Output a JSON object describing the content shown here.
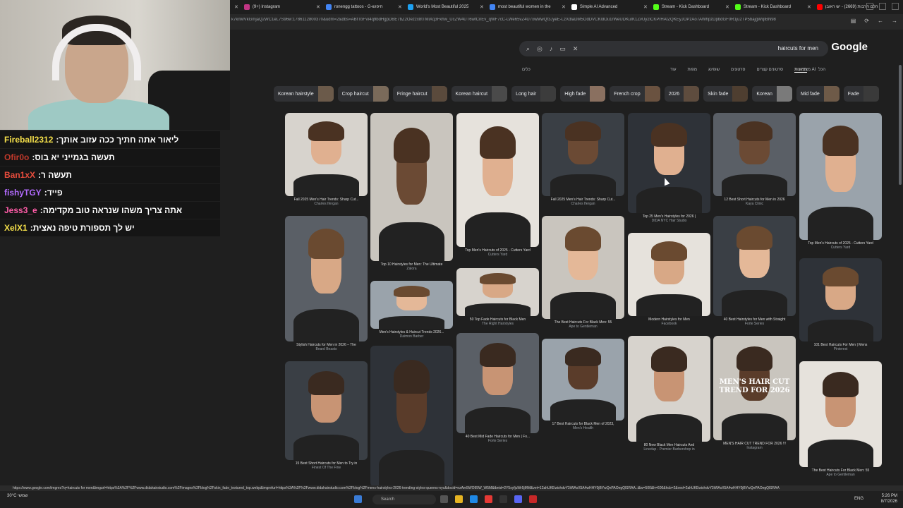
{
  "browser": {
    "tabs": [
      {
        "label": "(9+) Instagram",
        "color": "#c13584"
      },
      {
        "label": "ronengg tattoos - G-חיפוש",
        "color": "#4285f4"
      },
      {
        "label": "World's Most Beautiful 2025",
        "color": "#1da1f2"
      },
      {
        "label": "most beautiful women in the",
        "color": "#4285f4"
      },
      {
        "label": "Simple AI Advanced",
        "color": "#ffffff"
      },
      {
        "label": "Stream - Kick Dashboard",
        "color": "#53fc18"
      },
      {
        "label": "Stream - Kick Dashboard",
        "color": "#53fc18"
      },
      {
        "label": "הלם תרבות (2669) - יש ראובן",
        "color": "#ff0000"
      }
    ],
    "url": "k7knMVkGmjaQ2WC1eL7S96w:1786112800370&udm=2&dbs=ABfTbFVi4q9bdHgpDBE7bZ2Oezzx8tTMiXq3Fkhw_UcZW4UT6wfCnEv_qWF7cC-LWe65vZ4U7xwMwQf3JyeE-LzXdlaDM5OdDVCKldOu1rWeUDKuIK1ZvUy2iCKPrHAfZQKEyJOPzAo7AWhpzDpbdGF0R1ju2TP5bajgWqIBN98",
    "status_url": "https://www.google.com/imgres?q=haircuts for men&imgurl=https%3A%2F%2Fwww.didahairstudio.com%2Fimages%2Fblog%2Fskin_fade_textured_top.webp&imgrefurl=https%3A%2F%2Fwww.didahairstudio.com%2Fblog%2Fmens-hairstyles-2026-trending-styles-queens-nyc&docid=ezAm5WO95W_W5M&tbnid=2Y5syfjuWr5jMM&vet=12ahUKEwixhdvY3iWAxX5A4wHHY0jBYwQnPAOegQlSRAA..i&w=500&h=600&hcb=2&ved=2ahUKEwixhdvY3iWAxX5A4wHHY0jBYwQnPAOegQlSRAA"
  },
  "google": {
    "logo": "Google",
    "query": "haircuts for men",
    "filters": [
      "הכל",
      "תמונות",
      "סרטונים קצרים",
      "סרטונים",
      "שופינג",
      "מפות",
      "עוד"
    ],
    "active_filter": "תמונות",
    "left_tool": "כלים",
    "right_tool": "מצב AI",
    "chips": [
      "Korean hairstyle",
      "Crop haircut",
      "Fringe haircut",
      "Korean haircut",
      "Long hair",
      "High fade",
      "French crop",
      "2026",
      "Skin fade",
      "Korean",
      "Mid fade",
      "Fade"
    ]
  },
  "results": [
    {
      "caption": "Fall 2025 Men's Hair Trends: Sharp Cut...",
      "source": "Charles Ifergan"
    },
    {
      "caption": "Stylish Haircuts for Men in 2026 – The",
      "source": "Beard Beasts"
    },
    {
      "caption": "15 Best Short Haircuts for Men to Try in",
      "source": "Finest Of The Fine"
    },
    {
      "caption": "Top 10 Hairstyles for Men: The Ultimate",
      "source": "Zalora"
    },
    {
      "caption": "Men's Hairstyles & Haircut Trends 2026...",
      "source": "Daimon Barber"
    },
    {
      "caption": "",
      "source": ""
    },
    {
      "caption": "Top Men's Haircuts of 2025 - Cutters Yard",
      "source": "Cutters Yard"
    },
    {
      "caption": "50 Top Fade Haircuts for Black Men",
      "source": "The Right Hairstyles"
    },
    {
      "caption": "40 Best Mid Fade Haircuts for Men | Fo...",
      "source": "Forte Series"
    },
    {
      "caption": "Fall 2025 Men's Hair Trends: Sharp Cut...",
      "source": "Charles Ifergan"
    },
    {
      "caption": "The Best Haircuts For Black Men: 55",
      "source": "Ape to Gentleman"
    },
    {
      "caption": "17 Best Haircuts for Black Men of 2023,",
      "source": "Men's Health"
    },
    {
      "caption": "Top 25 Men's Hairstyles for 2026 |",
      "source": "DIDA NYC Hair Studio"
    },
    {
      "caption": "Modern Hairstyles for Men",
      "source": "Facebook"
    },
    {
      "caption": "80 New Black Men Haircuts And",
      "source": "Linedup - Premier Barbershop in"
    },
    {
      "caption": "12 Best Short Haircuts for Men in 2026",
      "source": "Kaya Clinic"
    },
    {
      "caption": "40 Best Hairstyles for Men with Straight",
      "source": "Forte Series"
    },
    {
      "caption": "MEN'S HAIR CUT TREND FOR 2026 !!!",
      "source": "Instagram"
    },
    {
      "caption": "Top Men's Haircuts of 2025 - Cutters Yard",
      "source": "Cutters Yard"
    },
    {
      "caption": "101 Best Haircuts For Men | Mens",
      "source": "Pinterest"
    },
    {
      "caption": "The Best Haircuts For Black Men: 55",
      "source": "Ape to Gentleman"
    }
  ],
  "overlay_text": "MEN'S HAIR CUT TREND FOR 2026",
  "chat": [
    {
      "user": "Fireball2312",
      "msg": "ליאור אתה חתיך ככה עזוב אותך",
      "color": "#f5e04a"
    },
    {
      "user": "Ofir0o",
      "msg": "תעשה בגמייני יא בוס",
      "color": "#c0392b"
    },
    {
      "user": "Ban1xX",
      "msg": "תעשה ר",
      "color": "#e74c3c"
    },
    {
      "user": "fishyTGY",
      "msg": "פייד",
      "color": "#b36bff"
    },
    {
      "user": "Jess3_e",
      "msg": "אתה צריך משהו שנראה טוב מקדימה",
      "color": "#ff5ca8"
    },
    {
      "user": "XelX1",
      "msg": "יש לך תספורת טיפה נאצית",
      "color": "#f5e04a"
    }
  ],
  "taskbar": {
    "weather": "30°C",
    "weather_sub": "שמשי",
    "search": "Search",
    "lang": "ENG",
    "time": "5:26 PM",
    "date": "8/7/2026"
  }
}
